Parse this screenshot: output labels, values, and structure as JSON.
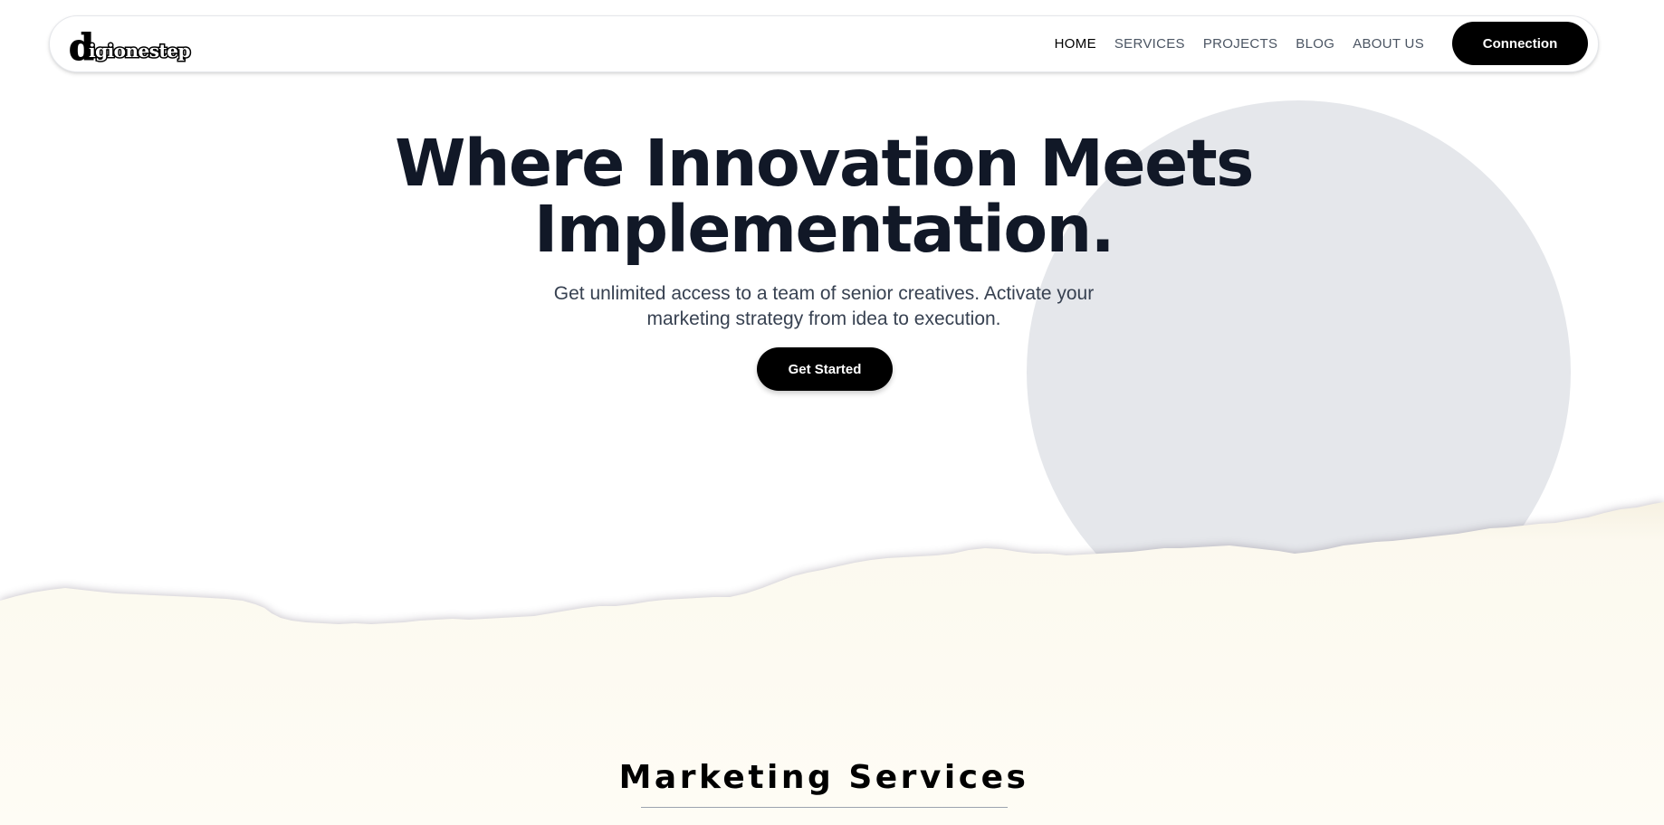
{
  "brand": {
    "logo_initial": "d",
    "logo_rest": "igionestep"
  },
  "nav": {
    "items": [
      {
        "label": "HOME",
        "active": true
      },
      {
        "label": "SERVICES",
        "active": false
      },
      {
        "label": "PROJECTS",
        "active": false
      },
      {
        "label": "BLOG",
        "active": false
      },
      {
        "label": "ABOUT US",
        "active": false
      }
    ],
    "cta_label": "Connection"
  },
  "hero": {
    "title_line1": "Where Innovation Meets",
    "title_line2": "Implementation.",
    "subtitle_line1": "Get unlimited access to a team of senior creatives. Activate your",
    "subtitle_line2": "marketing strategy from idea to execution.",
    "cta_label": "Get Started"
  },
  "services": {
    "heading": "Marketing Services"
  },
  "colors": {
    "accent": "#000000",
    "text_dark": "#111827",
    "text_muted": "#374151",
    "circle": "#e5e7eb",
    "paper": "#fefcf5"
  }
}
